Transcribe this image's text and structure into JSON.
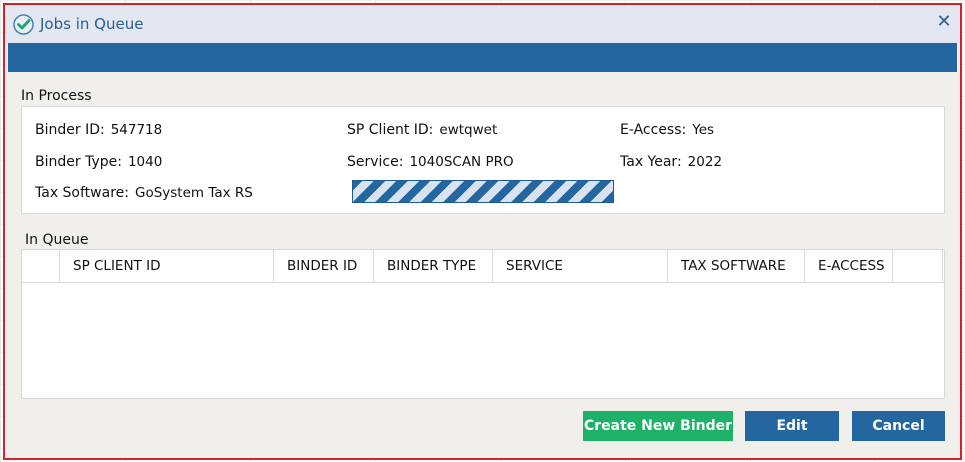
{
  "dialog": {
    "title": "Jobs in Queue",
    "close_icon": "close-icon",
    "title_icon": "checkmark-badge-icon"
  },
  "in_process": {
    "label": "In Process",
    "binder_id_label": "Binder ID:",
    "binder_id": "547718",
    "sp_client_id_label": "SP Client ID:",
    "sp_client_id": "ewtqwet",
    "e_access_label": "E-Access:",
    "e_access": "Yes",
    "binder_type_label": "Binder Type:",
    "binder_type": "1040",
    "service_label": "Service:",
    "service": "1040SCAN PRO",
    "tax_year_label": "Tax Year:",
    "tax_year": "2022",
    "tax_software_label": "Tax Software:",
    "tax_software": "GoSystem Tax RS",
    "progress_state": "indeterminate"
  },
  "in_queue": {
    "label": "In Queue",
    "columns": [
      "",
      "SP CLIENT ID",
      "BINDER ID",
      "BINDER TYPE",
      "SERVICE",
      "TAX SOFTWARE",
      "E-ACCESS",
      ""
    ],
    "rows": []
  },
  "buttons": {
    "create_label": "Create New Binder",
    "edit_label": "Edit",
    "cancel_label": "Cancel"
  },
  "colors": {
    "accent_blue": "#2466a0",
    "create_green": "#1db268",
    "border_red": "#d2232a"
  }
}
